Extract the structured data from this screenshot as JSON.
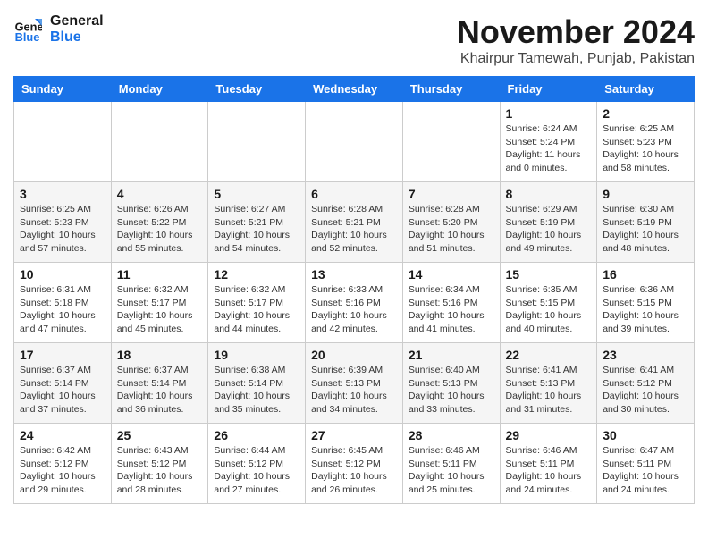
{
  "logo": {
    "line1": "General",
    "line2": "Blue"
  },
  "title": "November 2024",
  "location": "Khairpur Tamewah, Punjab, Pakistan",
  "weekdays": [
    "Sunday",
    "Monday",
    "Tuesday",
    "Wednesday",
    "Thursday",
    "Friday",
    "Saturday"
  ],
  "weeks": [
    [
      {
        "day": "",
        "info": ""
      },
      {
        "day": "",
        "info": ""
      },
      {
        "day": "",
        "info": ""
      },
      {
        "day": "",
        "info": ""
      },
      {
        "day": "",
        "info": ""
      },
      {
        "day": "1",
        "info": "Sunrise: 6:24 AM\nSunset: 5:24 PM\nDaylight: 11 hours and 0 minutes."
      },
      {
        "day": "2",
        "info": "Sunrise: 6:25 AM\nSunset: 5:23 PM\nDaylight: 10 hours and 58 minutes."
      }
    ],
    [
      {
        "day": "3",
        "info": "Sunrise: 6:25 AM\nSunset: 5:23 PM\nDaylight: 10 hours and 57 minutes."
      },
      {
        "day": "4",
        "info": "Sunrise: 6:26 AM\nSunset: 5:22 PM\nDaylight: 10 hours and 55 minutes."
      },
      {
        "day": "5",
        "info": "Sunrise: 6:27 AM\nSunset: 5:21 PM\nDaylight: 10 hours and 54 minutes."
      },
      {
        "day": "6",
        "info": "Sunrise: 6:28 AM\nSunset: 5:21 PM\nDaylight: 10 hours and 52 minutes."
      },
      {
        "day": "7",
        "info": "Sunrise: 6:28 AM\nSunset: 5:20 PM\nDaylight: 10 hours and 51 minutes."
      },
      {
        "day": "8",
        "info": "Sunrise: 6:29 AM\nSunset: 5:19 PM\nDaylight: 10 hours and 49 minutes."
      },
      {
        "day": "9",
        "info": "Sunrise: 6:30 AM\nSunset: 5:19 PM\nDaylight: 10 hours and 48 minutes."
      }
    ],
    [
      {
        "day": "10",
        "info": "Sunrise: 6:31 AM\nSunset: 5:18 PM\nDaylight: 10 hours and 47 minutes."
      },
      {
        "day": "11",
        "info": "Sunrise: 6:32 AM\nSunset: 5:17 PM\nDaylight: 10 hours and 45 minutes."
      },
      {
        "day": "12",
        "info": "Sunrise: 6:32 AM\nSunset: 5:17 PM\nDaylight: 10 hours and 44 minutes."
      },
      {
        "day": "13",
        "info": "Sunrise: 6:33 AM\nSunset: 5:16 PM\nDaylight: 10 hours and 42 minutes."
      },
      {
        "day": "14",
        "info": "Sunrise: 6:34 AM\nSunset: 5:16 PM\nDaylight: 10 hours and 41 minutes."
      },
      {
        "day": "15",
        "info": "Sunrise: 6:35 AM\nSunset: 5:15 PM\nDaylight: 10 hours and 40 minutes."
      },
      {
        "day": "16",
        "info": "Sunrise: 6:36 AM\nSunset: 5:15 PM\nDaylight: 10 hours and 39 minutes."
      }
    ],
    [
      {
        "day": "17",
        "info": "Sunrise: 6:37 AM\nSunset: 5:14 PM\nDaylight: 10 hours and 37 minutes."
      },
      {
        "day": "18",
        "info": "Sunrise: 6:37 AM\nSunset: 5:14 PM\nDaylight: 10 hours and 36 minutes."
      },
      {
        "day": "19",
        "info": "Sunrise: 6:38 AM\nSunset: 5:14 PM\nDaylight: 10 hours and 35 minutes."
      },
      {
        "day": "20",
        "info": "Sunrise: 6:39 AM\nSunset: 5:13 PM\nDaylight: 10 hours and 34 minutes."
      },
      {
        "day": "21",
        "info": "Sunrise: 6:40 AM\nSunset: 5:13 PM\nDaylight: 10 hours and 33 minutes."
      },
      {
        "day": "22",
        "info": "Sunrise: 6:41 AM\nSunset: 5:13 PM\nDaylight: 10 hours and 31 minutes."
      },
      {
        "day": "23",
        "info": "Sunrise: 6:41 AM\nSunset: 5:12 PM\nDaylight: 10 hours and 30 minutes."
      }
    ],
    [
      {
        "day": "24",
        "info": "Sunrise: 6:42 AM\nSunset: 5:12 PM\nDaylight: 10 hours and 29 minutes."
      },
      {
        "day": "25",
        "info": "Sunrise: 6:43 AM\nSunset: 5:12 PM\nDaylight: 10 hours and 28 minutes."
      },
      {
        "day": "26",
        "info": "Sunrise: 6:44 AM\nSunset: 5:12 PM\nDaylight: 10 hours and 27 minutes."
      },
      {
        "day": "27",
        "info": "Sunrise: 6:45 AM\nSunset: 5:12 PM\nDaylight: 10 hours and 26 minutes."
      },
      {
        "day": "28",
        "info": "Sunrise: 6:46 AM\nSunset: 5:11 PM\nDaylight: 10 hours and 25 minutes."
      },
      {
        "day": "29",
        "info": "Sunrise: 6:46 AM\nSunset: 5:11 PM\nDaylight: 10 hours and 24 minutes."
      },
      {
        "day": "30",
        "info": "Sunrise: 6:47 AM\nSunset: 5:11 PM\nDaylight: 10 hours and 24 minutes."
      }
    ]
  ]
}
